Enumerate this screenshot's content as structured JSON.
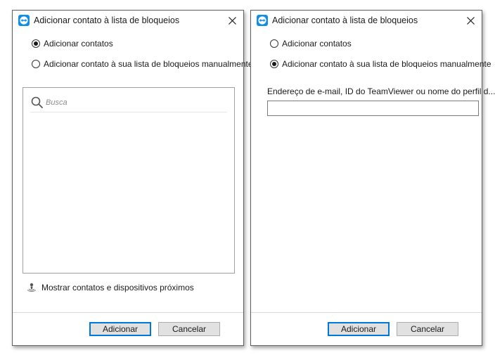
{
  "colors": {
    "accent": "#0078d7",
    "teamviewer_blue": "#0e8ee9"
  },
  "left_dialog": {
    "title": "Adicionar contato à lista de bloqueios",
    "title_icon": "teamviewer-icon",
    "close_icon": "close-icon",
    "options": [
      {
        "label": "Adicionar contatos",
        "selected": true
      },
      {
        "label": "Adicionar contato à sua lista de bloqueios manualmente",
        "selected": false
      }
    ],
    "search": {
      "placeholder": "Busca",
      "value": "",
      "icon": "search-icon"
    },
    "nearby_label": "Mostrar contatos e dispositivos próximos",
    "nearby_icon": "nearby-devices-icon",
    "ok_label": "Adicionar",
    "cancel_label": "Cancelar"
  },
  "right_dialog": {
    "title": "Adicionar contato à lista de bloqueios",
    "title_icon": "teamviewer-icon",
    "close_icon": "close-icon",
    "options": [
      {
        "label": "Adicionar contatos",
        "selected": false
      },
      {
        "label": "Adicionar contato à sua lista de bloqueios manualmente",
        "selected": true
      }
    ],
    "field_label": "Endereço de e-mail, ID do TeamViewer ou nome do perfil d...",
    "field_value": "",
    "ok_label": "Adicionar",
    "cancel_label": "Cancelar"
  }
}
